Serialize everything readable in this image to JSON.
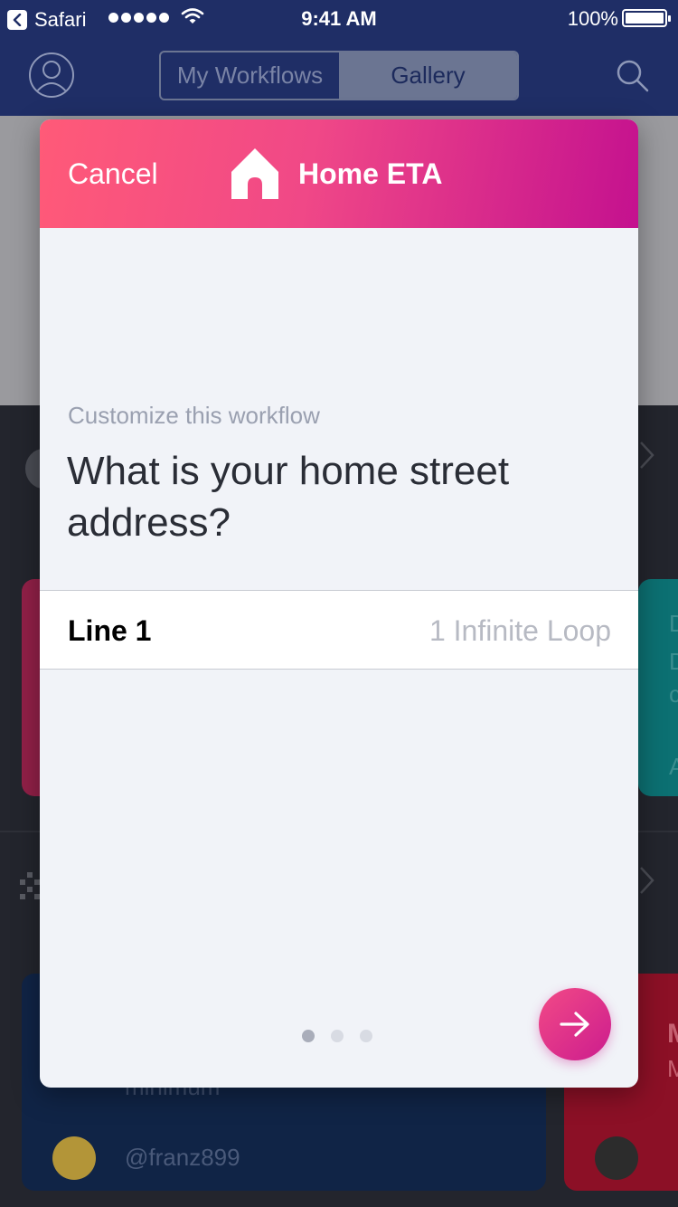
{
  "status_bar": {
    "back_app": "Safari",
    "time": "9:41 AM",
    "battery": "100%",
    "icons": [
      "back-chevron-icon",
      "signal-dots-icon",
      "wifi-icon",
      "battery-icon"
    ]
  },
  "background_app": {
    "segments": [
      {
        "label": "My Workflows",
        "selected": false
      },
      {
        "label": "Gallery",
        "selected": true
      }
    ],
    "profile_icon": "person-icon",
    "search_icon": "search-icon",
    "card_text": "minimum",
    "author_handle": "@franz899",
    "teal_card_fragments": [
      "D",
      "D",
      "c",
      "A"
    ],
    "red_card_fragments": [
      "M",
      "M"
    ]
  },
  "modal": {
    "cancel_label": "Cancel",
    "icon": "home-icon",
    "title": "Home ETA",
    "subtitle": "Customize this workflow",
    "question": "What is your home street address?",
    "field": {
      "label": "Line 1",
      "placeholder": "1 Infinite Loop",
      "value": ""
    },
    "pagination": {
      "total": 3,
      "current": 1
    },
    "next_icon": "arrow-right-icon"
  },
  "colors": {
    "nav_bar": "#1f2e66",
    "header_gradient_start": "#ff5a78",
    "header_gradient_end": "#c4118f",
    "modal_background": "#f1f3f8",
    "next_button": "#e0338a"
  }
}
